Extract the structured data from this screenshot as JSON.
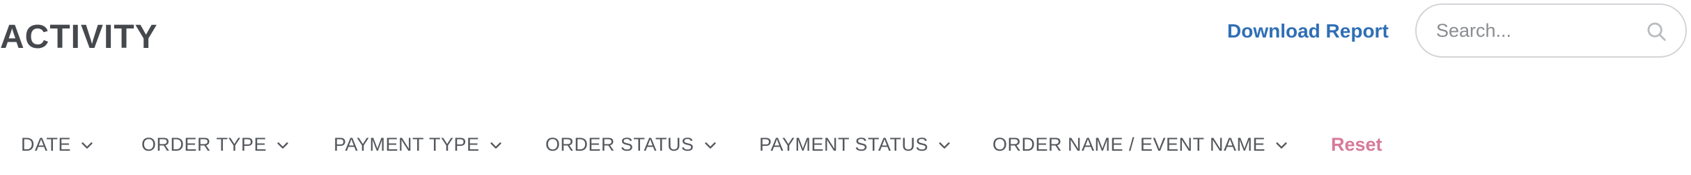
{
  "header": {
    "title": "ACTIVITY",
    "download_label": "Download Report",
    "search": {
      "placeholder": "Search...",
      "value": "",
      "icon": "search-icon"
    }
  },
  "filters": {
    "items": [
      {
        "label": "DATE",
        "icon": "chevron-down-icon"
      },
      {
        "label": "ORDER TYPE",
        "icon": "chevron-down-icon"
      },
      {
        "label": "PAYMENT TYPE",
        "icon": "chevron-down-icon"
      },
      {
        "label": "ORDER STATUS",
        "icon": "chevron-down-icon"
      },
      {
        "label": "PAYMENT STATUS",
        "icon": "chevron-down-icon"
      },
      {
        "label": "ORDER NAME / EVENT NAME",
        "icon": "chevron-down-icon"
      }
    ],
    "reset_label": "Reset"
  },
  "colors": {
    "link": "#2f6fb5",
    "reset": "#d77a98",
    "text": "#4a4d52"
  }
}
